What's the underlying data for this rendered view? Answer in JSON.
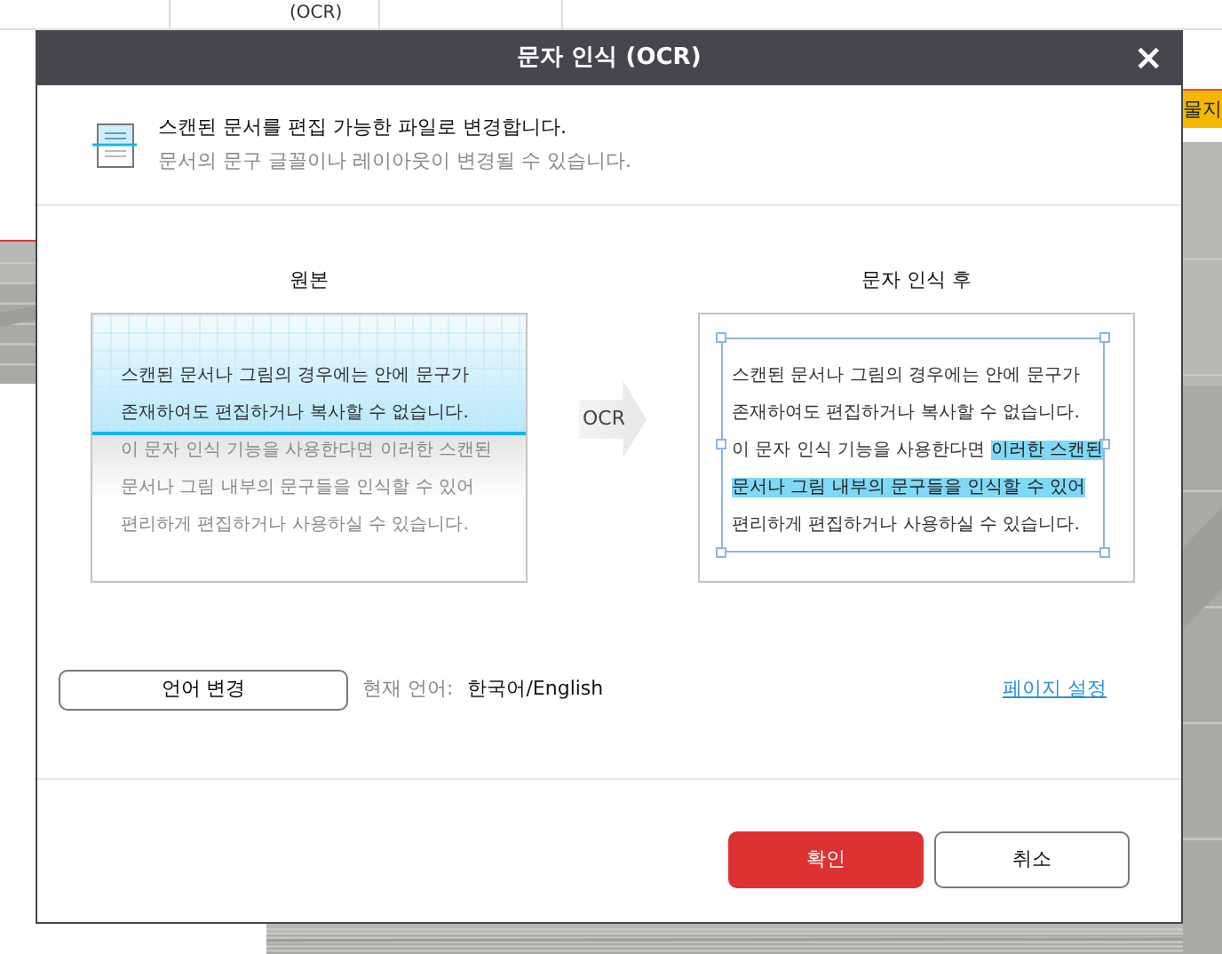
{
  "background": {
    "toolbar_text": "(OCR)",
    "side_tab": "물지"
  },
  "dialog": {
    "title": "문자 인식 (OCR)",
    "close": "×",
    "heading": "스캔된 문서를 편집 가능한 파일로 변경합니다.",
    "subheading": "문서의 문구 글꼴이나 레이아웃이 변경될 수 있습니다.",
    "before": {
      "label": "원본",
      "lines": [
        {
          "text": "스캔된 문서나 그림의 경우에는 안에 문구가",
          "scanned": true
        },
        {
          "text": "존재하여도 편집하거나 복사할 수 없습니다.",
          "scanned": true
        },
        {
          "text": "이 문자 인식 기능을 사용한다면 이러한 스캔된",
          "scanned": false
        },
        {
          "text": "문서나 그림 내부의 문구들을 인식할 수 있어",
          "scanned": false
        },
        {
          "text": "편리하게 편집하거나 사용하실 수 있습니다.",
          "scanned": false
        }
      ]
    },
    "arrow_label": "OCR",
    "after": {
      "label": "문자 인식 후",
      "lines": [
        [
          {
            "text": "스캔된 문서나 그림의 경우에는 안에 문구가",
            "highlighted": false
          }
        ],
        [
          {
            "text": "존재하여도 편집하거나 복사할 수 없습니다.",
            "highlighted": false
          }
        ],
        [
          {
            "text": "이 문자 인식 기능을 사용한다면 ",
            "highlighted": false
          },
          {
            "text": "이러한 스캔된",
            "highlighted": true
          }
        ],
        [
          {
            "text": "문서나 그림 내부의 문구들을 인식할 수 있어",
            "highlighted": true
          }
        ],
        [
          {
            "text": "편리하게 편집하거나 사용하실 수 있습니다.",
            "highlighted": false
          }
        ]
      ]
    },
    "language_button": "언어 변경",
    "current_language_label": "현재 언어:",
    "current_language": "한국어/English",
    "page_settings_link": "페이지 설정",
    "buttons": [
      {
        "label": "확인",
        "kind": "primary"
      },
      {
        "label": "취소",
        "kind": "secondary"
      }
    ]
  }
}
